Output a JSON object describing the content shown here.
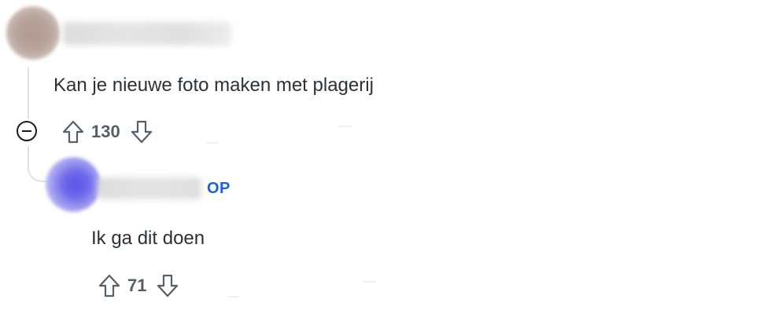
{
  "comment": {
    "username": "",
    "text": "Kan je nieuwe foto maken met plagerij",
    "score": "130",
    "colors": {
      "text": "#2a3238",
      "score": "#575f66"
    }
  },
  "reply": {
    "username": "",
    "op_badge": "OP",
    "text": "Ik ga dit doen",
    "score": "71",
    "colors": {
      "op_badge": "#1c63d6"
    }
  },
  "icons": {
    "collapse": "minus-circle-icon",
    "upvote": "arrow-up-outline-icon",
    "downvote": "arrow-down-outline-icon"
  }
}
